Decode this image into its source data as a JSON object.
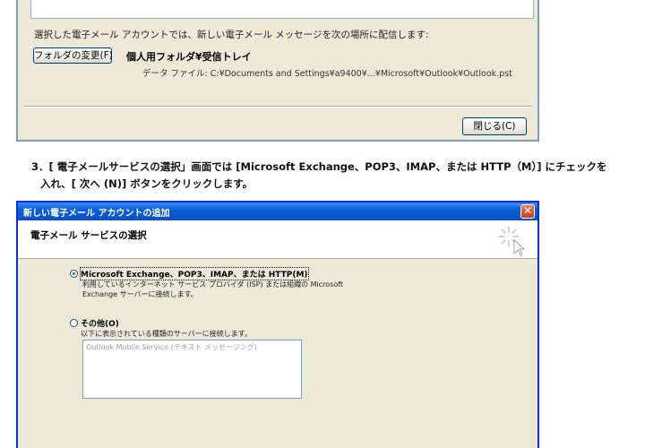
{
  "top_dialog": {
    "deliver_text": "選択した電子メール アカウントでは、新しい電子メール メッセージを次の場所に配信します:",
    "change_folder_button": "フォルダの変更(F)",
    "folder_name": "個人用フォルダ¥受信トレイ",
    "data_file": "データ ファイル: C:¥Documents and Settings¥a9400¥...¥Microsoft¥Outlook¥Outlook.pst",
    "close_button": "閉じる(C)"
  },
  "instruction": {
    "line1": "3．[ 電子メールサービスの選択」画面では [Microsoft Exchange、POP3、IMAP、または HTTP（M）] にチェックを",
    "line2": "入れ、[ 次へ (N)] ボタンをクリックします。"
  },
  "wizard": {
    "title": "新しい電子メール アカウントの追加",
    "close_icon_glyph": "✕",
    "header_title": "電子メール サービスの選択",
    "option1": {
      "label": "Microsoft Exchange、POP3、IMAP、または HTTP(M)",
      "desc_line1": "利用しているインターネット サービス プロバイダ (ISP) または組織の Microsoft",
      "desc_line2": "Exchange サーバーに接続します。",
      "selected": true
    },
    "option2": {
      "label": "その他(O)",
      "desc": "以下に表示されている種類のサーバーに接続します。",
      "selected": false
    },
    "service_list": [
      "Outlook Mobile Service (テキスト メッセージング)"
    ]
  },
  "colors": {
    "dialog_bg": "#ece9d8",
    "titlebar": "#0a5fd8",
    "close_button": "#c8401e"
  },
  "icons": [
    "close-icon",
    "sparkle-icon",
    "radio-selected-icon",
    "radio-unselected-icon"
  ]
}
